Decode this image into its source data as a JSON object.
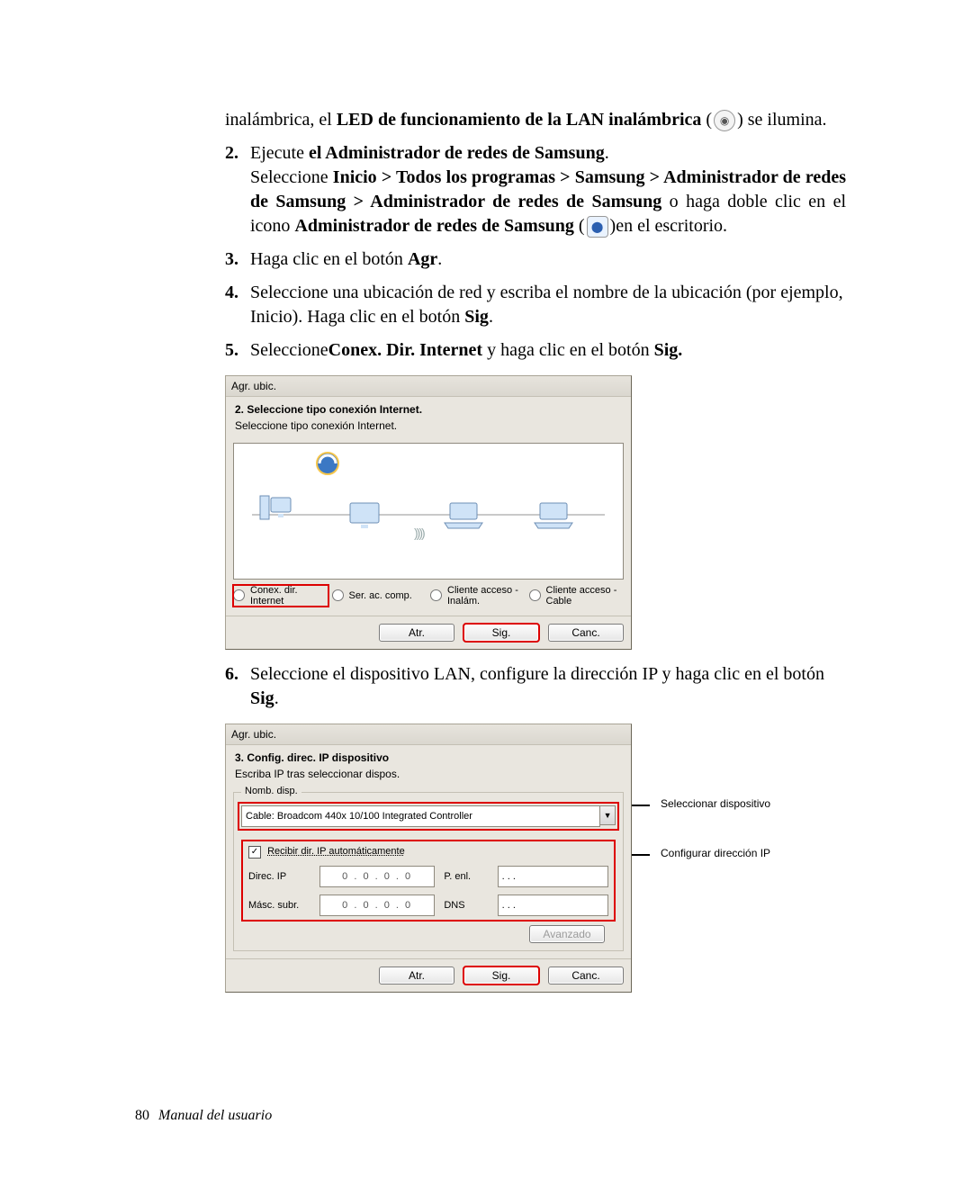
{
  "intro": {
    "pre": "inalámbrica, el ",
    "bold": "LED de funcionamiento de la LAN inalámbrica",
    "post_open": " (",
    "post_close": ") se ilumina."
  },
  "steps": {
    "s2": {
      "num": "2.",
      "line1_pre": "Ejecute ",
      "line1_bold": "el Administrador de redes de Samsung",
      "line1_post": ".",
      "line2_pre": "Seleccione ",
      "line2_bold": "Inicio > Todos los programas > Samsung > Administrador de redes de Samsung > Administrador de redes de Samsung",
      "line2_mid": " o haga doble clic en el icono ",
      "line2_bold2": "Administrador de redes de Samsung",
      "line2_open": " (",
      "line2_close": ")en el escritorio."
    },
    "s3": {
      "num": "3.",
      "pre": "Haga clic en el botón ",
      "bold": "Agr",
      "post": "."
    },
    "s4": {
      "num": "4.",
      "text_a": "Seleccione una ubicación de red y escriba el nombre de la ubicación (por ejemplo, Inicio). Haga clic en el botón ",
      "bold": "Sig",
      "post": "."
    },
    "s5": {
      "num": "5.",
      "pre": "Seleccione",
      "bold1": "Conex. Dir. Internet",
      "mid": " y haga clic en el botón ",
      "bold2": "Sig."
    },
    "s6": {
      "num": "6.",
      "text": "Seleccione el dispositivo LAN, configure la dirección IP y haga clic en el botón ",
      "bold": "Sig",
      "post": "."
    }
  },
  "dlg1": {
    "title": "Agr. ubic.",
    "section_title": "2. Seleccione tipo conexión Internet.",
    "section_sub": "Seleccione tipo conexión Internet.",
    "radios": {
      "r1": "Conex. dir. Internet",
      "r2": "Ser. ac. comp.",
      "r3": "Cliente acceso - Inalám.",
      "r4": "Cliente acceso - Cable"
    },
    "buttons": {
      "back": "Atr.",
      "next": "Sig.",
      "cancel": "Canc."
    }
  },
  "dlg2": {
    "title": "Agr. ubic.",
    "section_title": "3. Config. direc. IP dispositivo",
    "section_sub": "Escriba IP tras seleccionar dispos.",
    "group_title": "Nomb. disp.",
    "device_value": "Cable: Broadcom 440x 10/100 Integrated Controller",
    "auto_ip": "Recibir dir. IP automáticamente",
    "labels": {
      "ip": "Direc. IP",
      "mask": "Másc. subr.",
      "gw": "P. enl.",
      "dns": "DNS"
    },
    "ip_placeholder": "0  .  0  .  0  .  0",
    "dot_placeholder": ".     .     .",
    "advanced": "Avanzado",
    "buttons": {
      "back": "Atr.",
      "next": "Sig.",
      "cancel": "Canc."
    },
    "callouts": {
      "c1": "Seleccionar dispositivo",
      "c2": "Configurar dirección IP"
    }
  },
  "footer": {
    "page": "80",
    "label": "Manual del usuario"
  }
}
